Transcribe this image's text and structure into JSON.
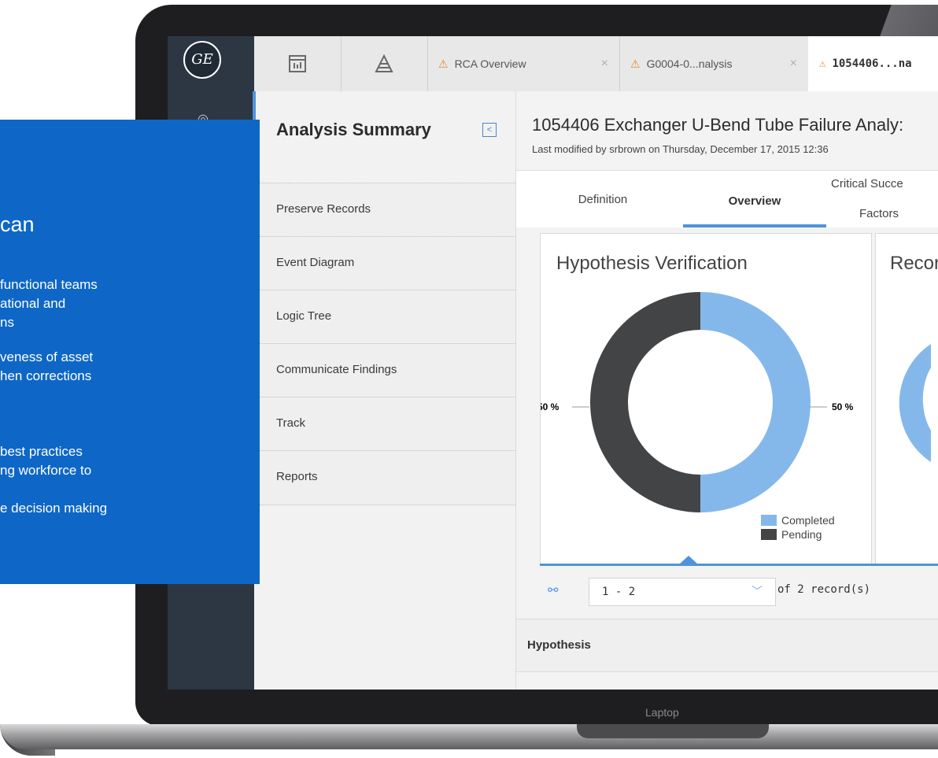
{
  "device": {
    "label": "Laptop"
  },
  "app": {
    "logo_text": "GE",
    "tabs": [
      {
        "icon": "dashboard-icon"
      },
      {
        "icon": "pyramid-icon"
      },
      {
        "label": "RCA Overview",
        "closable": true
      },
      {
        "label": "G0004-0...nalysis",
        "closable": true
      },
      {
        "label": "1054406...na",
        "active": true
      }
    ],
    "close_glyph": "×"
  },
  "summary": {
    "title": "Analysis Summary",
    "collapse_glyph": "<",
    "items": [
      "Preserve Records",
      "Event Diagram",
      "Logic Tree",
      "Communicate Findings",
      "Track",
      "Reports"
    ]
  },
  "main": {
    "title": "1054406 Exchanger U-Bend Tube Failure Analy:",
    "subtitle": "Last modified by srbrown on Thursday, December 17, 2015 12:36",
    "subtabs": [
      "Definition",
      "Overview",
      "Critical Succe",
      "Factors"
    ],
    "active_subtab": "Overview",
    "card1": {
      "title": "Hypothesis Verification",
      "left_pct": "50 %",
      "right_pct": "50 %"
    },
    "card2": {
      "title": "Recor"
    },
    "pager": {
      "range": "1 - 2",
      "records": "of 2 record(s)"
    },
    "table_header": "Hypothesis"
  },
  "chart_data": {
    "type": "pie",
    "title": "Hypothesis Verification",
    "categories": [
      "Completed",
      "Pending"
    ],
    "values": [
      50,
      50
    ],
    "colors": [
      "#85b8ea",
      "#434446"
    ],
    "legend": "bottom-right"
  },
  "overlay": {
    "heading": "can",
    "lines": [
      "functional teams",
      "ational and",
      "ns",
      "veness of asset",
      "hen corrections",
      "",
      "best practices",
      "ng workforce to",
      "e decision making"
    ]
  }
}
